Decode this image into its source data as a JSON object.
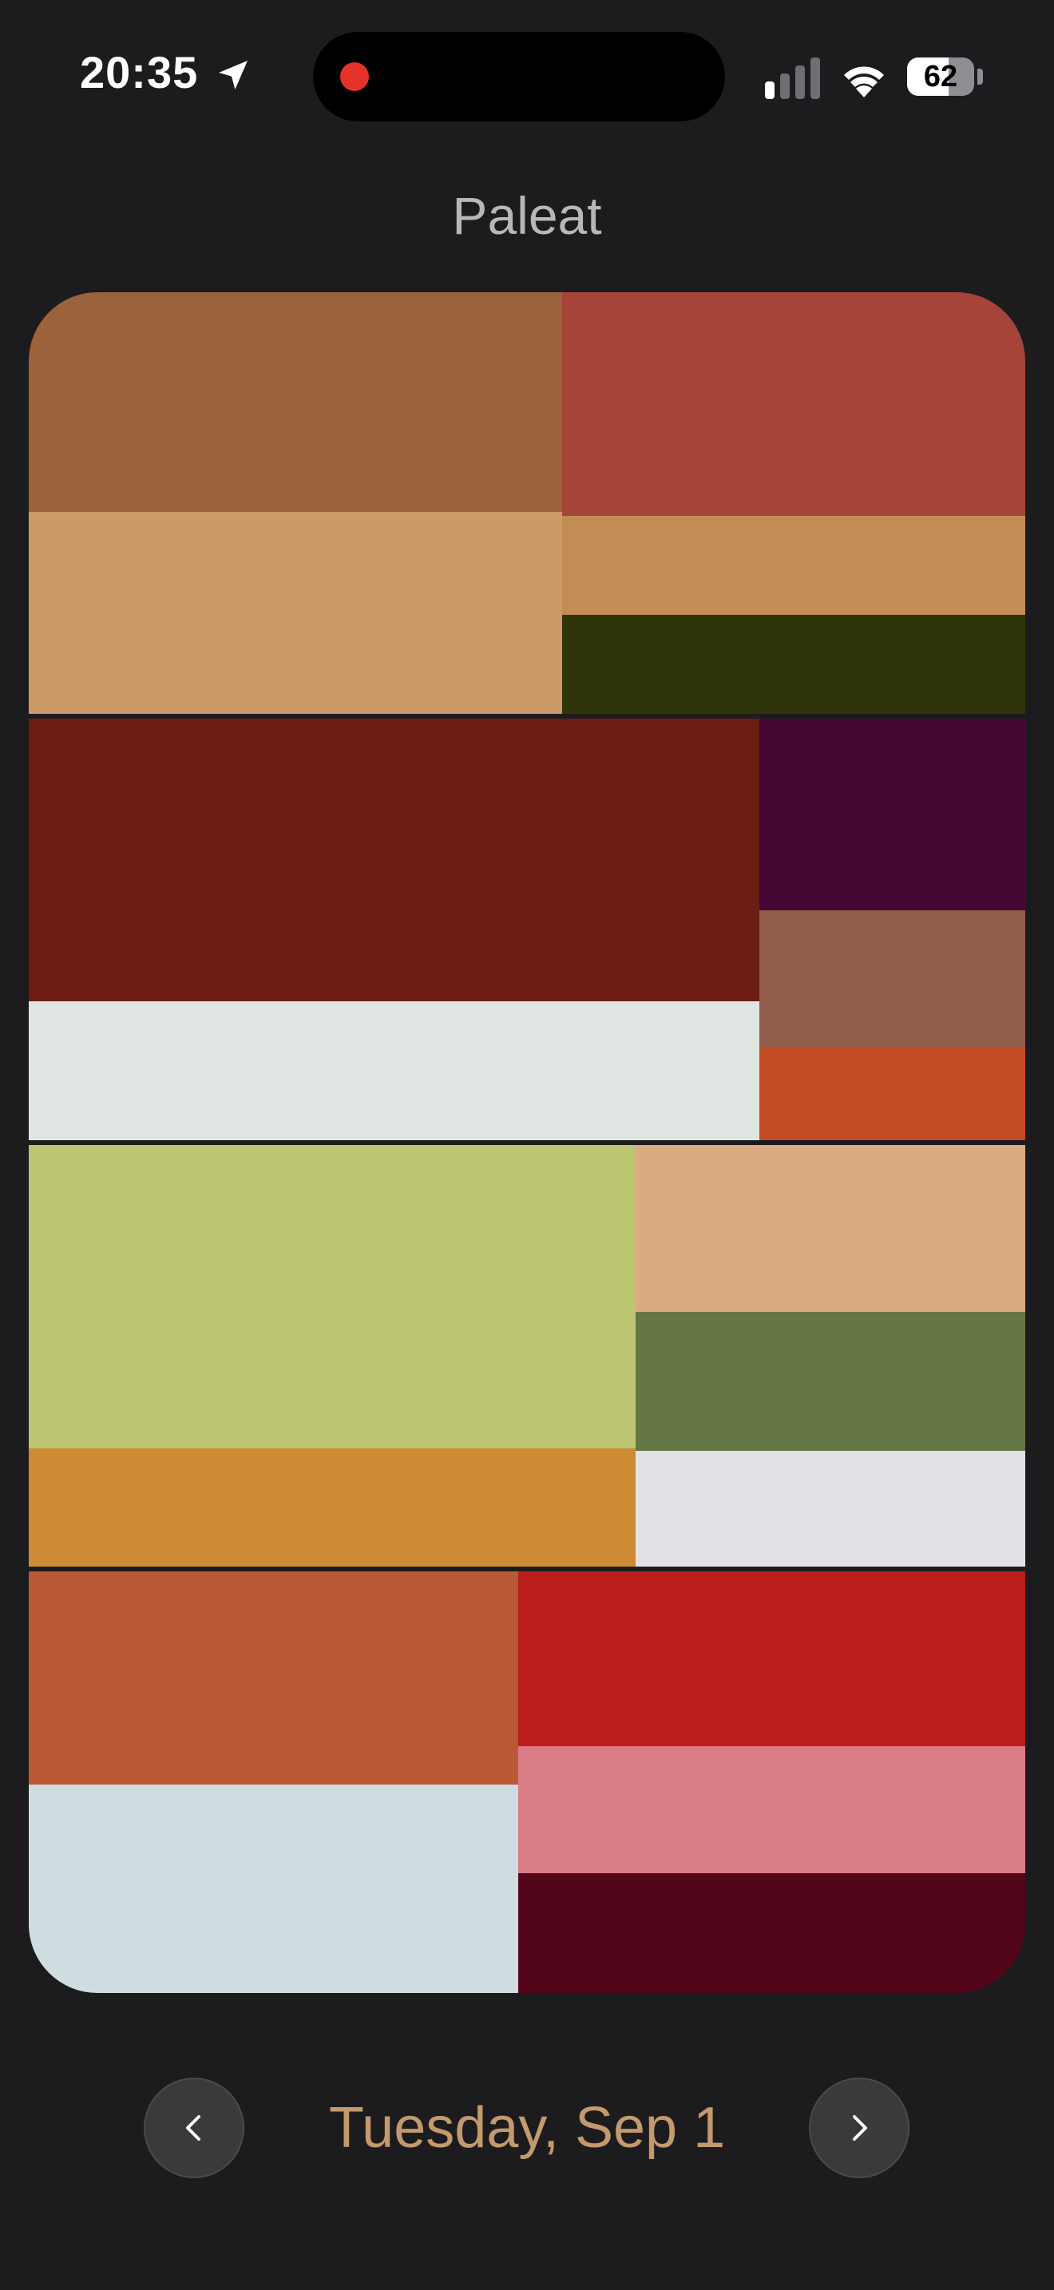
{
  "status_bar": {
    "time": "20:35",
    "battery_percent": "62",
    "battery_level": 0.62,
    "location_icon": "location-arrow-icon",
    "signal_icon": "cellular-signal-icon",
    "wifi_icon": "wifi-icon",
    "recording_indicator_color": "#e5332a"
  },
  "app": {
    "title": "Paleat"
  },
  "palettes": [
    {
      "columns": [
        {
          "swatches": [
            {
              "color": "#9c623c",
              "share": 0.52
            },
            {
              "color": "#cd9966",
              "share": 0.48
            }
          ]
        },
        {
          "swatches": [
            {
              "color": "#a6443a",
              "share": 0.53
            },
            {
              "color": "#c28e55",
              "share": 0.235
            },
            {
              "color": "#30340b",
              "share": 0.235
            }
          ]
        }
      ],
      "column_shares": [
        0.535,
        0.465
      ]
    },
    {
      "columns": [
        {
          "swatches": [
            {
              "color": "#6b1d13",
              "share": 0.67
            },
            {
              "color": "#dfe6e1",
              "share": 0.33
            }
          ]
        },
        {
          "swatches": [
            {
              "color": "#460833",
              "share": 0.455
            },
            {
              "color": "#915c4c",
              "share": 0.325
            },
            {
              "color": "#c24b23",
              "share": 0.22
            }
          ]
        }
      ],
      "column_shares": [
        0.733,
        0.267
      ]
    },
    {
      "columns": [
        {
          "swatches": [
            {
              "color": "#bbc572",
              "share": 0.72
            },
            {
              "color": "#cd8b33",
              "share": 0.28
            }
          ]
        },
        {
          "swatches": [
            {
              "color": "#dcaa81",
              "share": 0.395
            },
            {
              "color": "#657645",
              "share": 0.33
            },
            {
              "color": "#e1e2e5",
              "share": 0.275
            }
          ]
        }
      ],
      "column_shares": [
        0.609,
        0.391
      ]
    },
    {
      "columns": [
        {
          "swatches": [
            {
              "color": "#ba5935",
              "share": 0.505
            },
            {
              "color": "#cfdce0",
              "share": 0.495
            }
          ]
        },
        {
          "swatches": [
            {
              "color": "#b91d1d",
              "share": 0.415
            },
            {
              "color": "#da7c86",
              "share": 0.3
            },
            {
              "color": "#530619",
              "share": 0.285
            }
          ]
        }
      ],
      "column_shares": [
        0.491,
        0.509
      ]
    }
  ],
  "navigation": {
    "prev_icon": "chevron-left-icon",
    "next_icon": "chevron-right-icon",
    "date": "Tuesday, Sep 1",
    "date_color": "#c39a6d"
  }
}
